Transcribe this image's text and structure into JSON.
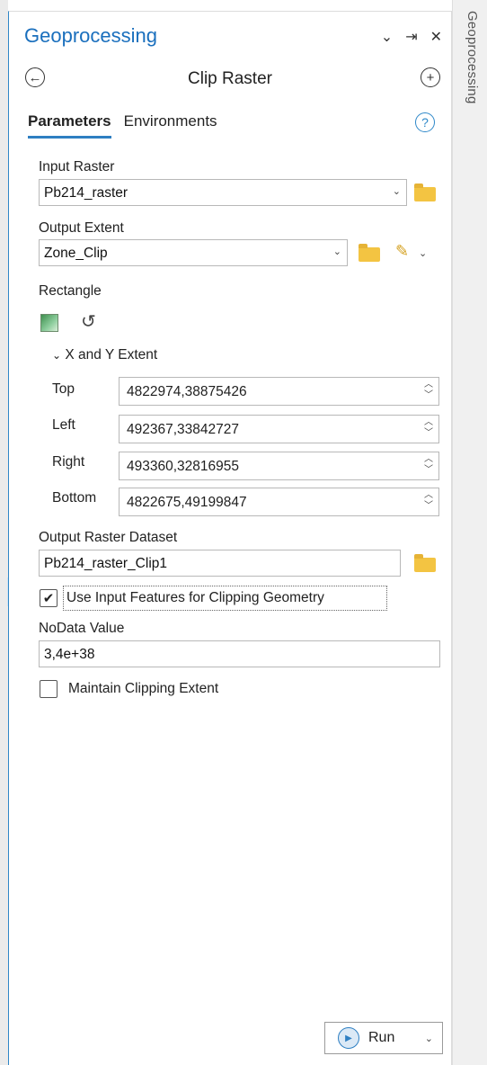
{
  "pane": {
    "title": "Geoprocessing",
    "side_tab_label": "Geoprocessing",
    "controls": {
      "dropdown": "⌄",
      "pin": "⇥",
      "close": "✕"
    }
  },
  "tool": {
    "title": "Clip Raster",
    "back_icon": "back-icon",
    "add_icon": "add-icon"
  },
  "tabs": [
    {
      "label": "Parameters",
      "active": true
    },
    {
      "label": "Environments",
      "active": false
    }
  ],
  "help_icon": "?",
  "params": {
    "input_raster": {
      "label": "Input Raster",
      "value": "Pb214_raster"
    },
    "output_extent": {
      "label": "Output Extent",
      "value": "Zone_Clip"
    },
    "rectangle": {
      "label": "Rectangle"
    },
    "xy_extent": {
      "label": "X and Y Extent",
      "fields": [
        {
          "label": "Top",
          "value": "4822974,38875426"
        },
        {
          "label": "Left",
          "value": "492367,33842727"
        },
        {
          "label": "Right",
          "value": "493360,32816955"
        },
        {
          "label": "Bottom",
          "value": "4822675,49199847"
        }
      ]
    },
    "output_raster": {
      "label": "Output Raster Dataset",
      "value": "Pb214_raster_Clip1"
    },
    "use_input_features": {
      "label": "Use Input Features for Clipping Geometry",
      "checked": true
    },
    "nodata": {
      "label": "NoData Value",
      "value": "3,4e+38"
    },
    "maintain_extent": {
      "label": "Maintain Clipping Extent",
      "checked": false
    }
  },
  "run_button": {
    "label": "Run"
  },
  "colors": {
    "accent": "#1a6fbd",
    "folder": "#f3c442"
  }
}
